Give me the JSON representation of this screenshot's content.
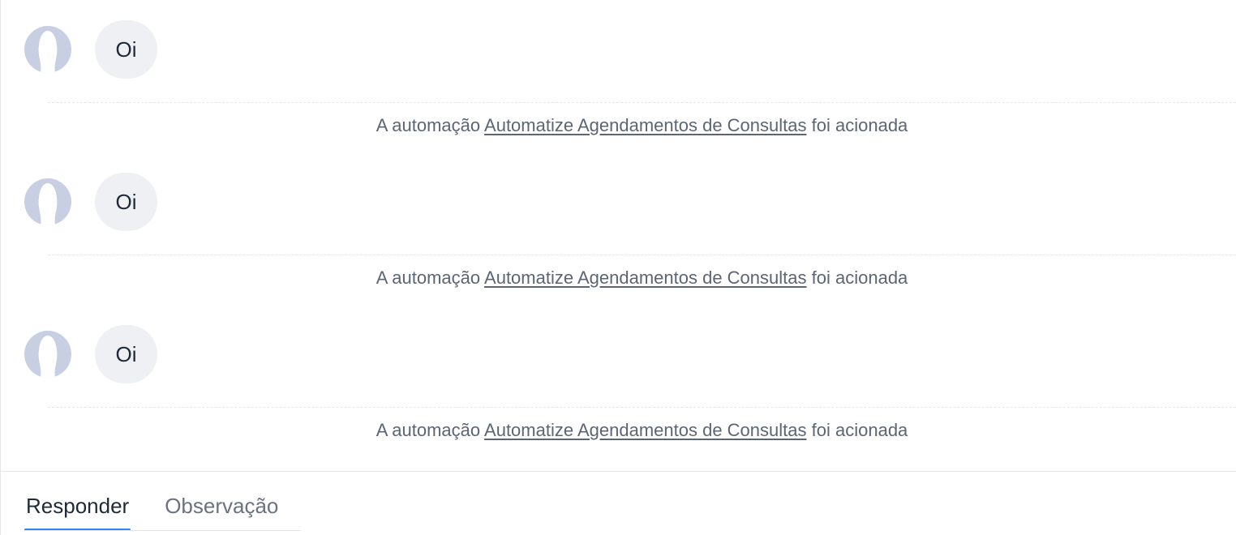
{
  "thread": {
    "items": [
      {
        "message": {
          "text": "Oi",
          "avatar_icon": "user-silhouette-icon"
        },
        "event": {
          "prefix": "A automação",
          "link": "Automatize Agendamentos de Consultas",
          "suffix": "foi acionada"
        }
      },
      {
        "message": {
          "text": "Oi",
          "avatar_icon": "user-silhouette-icon"
        },
        "event": {
          "prefix": "A automação",
          "link": "Automatize Agendamentos de Consultas",
          "suffix": "foi acionada"
        }
      },
      {
        "message": {
          "text": "Oi",
          "avatar_icon": "user-silhouette-icon"
        },
        "event": {
          "prefix": "A automação",
          "link": "Automatize Agendamentos de Consultas",
          "suffix": "foi acionada"
        }
      }
    ]
  },
  "composer": {
    "tabs": [
      {
        "label": "Responder",
        "active": true
      },
      {
        "label": "Observação",
        "active": false
      }
    ]
  },
  "colors": {
    "accent": "#3b82f6",
    "avatar_bg": "#c9cfe2",
    "bubble_bg": "#eef0f3",
    "muted_text": "#5b6576"
  }
}
